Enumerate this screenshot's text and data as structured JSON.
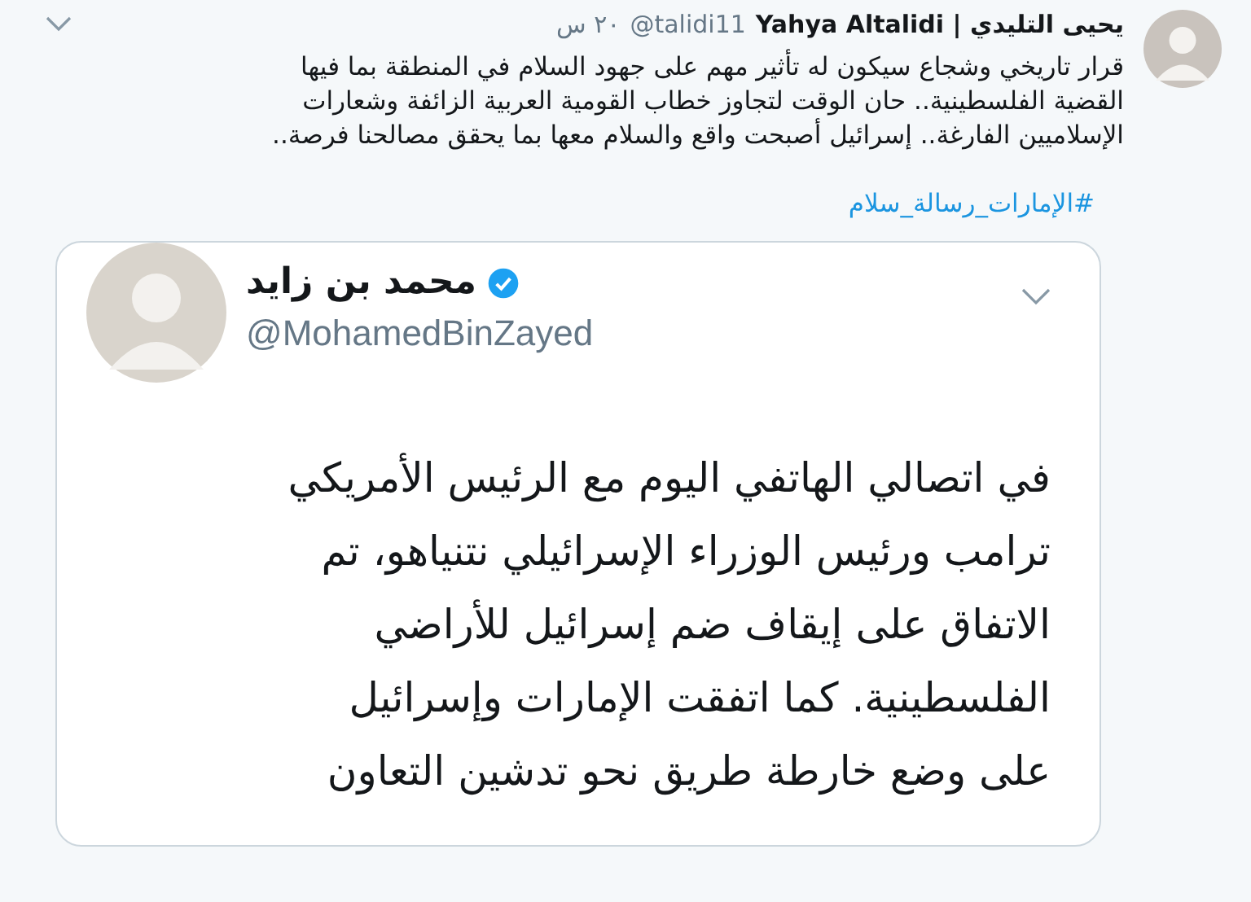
{
  "tweet": {
    "author_name": "Yahya Altalidi | يحيى التليدي",
    "handle": "@talidi11",
    "time": "٢٠ س",
    "text": "قرار تاريخي وشجاع سيكون له تأثير مهم على جهود السلام في المنطقة بما فيها\nالقضية الفلسطينية.. حان الوقت لتجاوز خطاب القومية العربية الزائفة وشعارات\nالإسلاميين الفارغة.. إسرائيل أصبحت واقع والسلام معها بما يحقق مصالحنا فرصة..",
    "hashtag": "#الإمارات_رسالة_سلام",
    "quoted": {
      "author_name": "محمد بن زايد",
      "verified": true,
      "handle": "@MohamedBinZayed",
      "text": "في اتصالي الهاتفي اليوم مع الرئيس الأمريكي\nترامب ورئيس الوزراء الإسرائيلي نتنياهو، تم\nالاتفاق على إيقاف ضم إسرائيل للأراضي\nالفلسطينية. كما اتفقت الإمارات وإسرائيل\nعلى وضع خارطة طريق نحو تدشين التعاون"
    }
  }
}
